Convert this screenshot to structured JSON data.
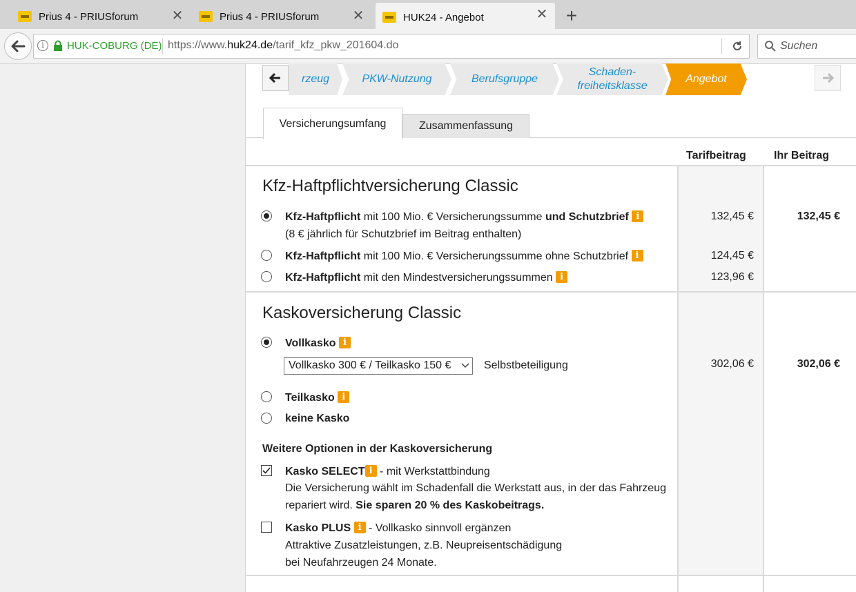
{
  "browser": {
    "tabs": [
      {
        "title": "Prius 4 - PRIUSforum",
        "active": false
      },
      {
        "title": "Prius 4 - PRIUSforum",
        "active": false
      },
      {
        "title": "HUK24 - Angebot",
        "active": true
      }
    ],
    "identity": "HUK-COBURG (DE)",
    "url_prefix": "https://www.",
    "url_domain": "huk24.de",
    "url_path": "/tarif_kfz_pkw_201604.do",
    "search_placeholder": "Suchen"
  },
  "steps": [
    {
      "label": "rzeug",
      "active": false
    },
    {
      "label": "PKW-Nutzung",
      "active": false
    },
    {
      "label": "Berufsgruppe",
      "active": false
    },
    {
      "label_line1": "Schaden-",
      "label_line2": "freiheitsklasse",
      "active": false
    },
    {
      "label": "Angebot",
      "active": true
    }
  ],
  "tabs": [
    "Versicherungsumfang",
    "Zusammenfassung"
  ],
  "columns": {
    "tarif": "Tarifbeitrag",
    "ihr": "Ihr Beitrag"
  },
  "haftpflicht": {
    "title": "Kfz-Haftpflichtversicherung Classic",
    "options": [
      {
        "bold": "Kfz-Haftpflicht",
        "text": " mit 100 Mio. € Versicherungssumme ",
        "bold2": "und Schutzbrief",
        "note": "(8 € jährlich für Schutzbrief im Beitrag enthalten)",
        "price": "132,45 €",
        "selected": true
      },
      {
        "bold": "Kfz-Haftpflicht",
        "text": " mit 100 Mio. € Versicherungssumme ohne Schutzbrief",
        "price": "124,45 €",
        "selected": false
      },
      {
        "bold": "Kfz-Haftpflicht",
        "text": " mit den Mindestversicherungssummen",
        "price": "123,96 €",
        "selected": false
      }
    ],
    "ihr_beitrag": "132,45 €"
  },
  "kasko": {
    "title": "Kaskoversicherung Classic",
    "vollkasko": "Vollkasko",
    "select_value": "Vollkasko 300 € / Teilkasko 150 €",
    "selbstbeteiligung": "Selbstbeteiligung",
    "price": "302,06 €",
    "ihr_beitrag": "302,06 €",
    "teilkasko": "Teilkasko",
    "keine": "keine Kasko",
    "weitere_title": "Weitere Optionen in der Kaskoversicherung",
    "select_opt": {
      "name": "Kasko SELECT",
      "suffix": " - mit Werkstattbindung",
      "line1": "Die Versicherung wählt im Schadenfall die Werkstatt aus, in der das Fahrzeug",
      "line2a": "repariert wird. ",
      "line2b": "Sie sparen 20 % des Kaskobeitrags.",
      "checked": true
    },
    "plus_opt": {
      "name": "Kasko PLUS",
      "suffix": " - Vollkasko sinnvoll ergänzen",
      "line1": "Attraktive Zusatzleistungen, z.B. Neupreisentschädigung",
      "line2": "bei Neufahrzeugen 24 Monate.",
      "checked": false
    }
  },
  "colors": {
    "accent": "#f39c00",
    "link": "#1a8fd0",
    "secure": "#2e9e2e"
  }
}
